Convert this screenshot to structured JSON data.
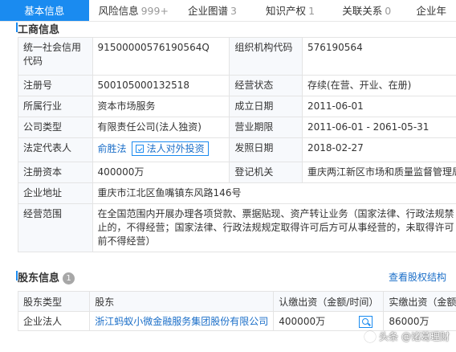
{
  "tabs": [
    {
      "label": "基本信息",
      "count": ""
    },
    {
      "label": "风险信息",
      "count": "999+"
    },
    {
      "label": "企业图谱",
      "count": "3"
    },
    {
      "label": "知识产权",
      "count": "1"
    },
    {
      "label": "关联关系",
      "count": "0"
    },
    {
      "label": "企业年",
      "count": ""
    }
  ],
  "business": {
    "title": "工商信息",
    "credit_code_label": "统一社会信用代码",
    "credit_code": "91500000576190564Q",
    "org_code_label": "组织机构代码",
    "org_code": "576190564",
    "reg_no_label": "注册号",
    "reg_no": "500105000132518",
    "status_label": "经营状态",
    "status": "存续(在营、开业、在册)",
    "industry_label": "所属行业",
    "industry": "资本市场服务",
    "founded_label": "成立日期",
    "founded": "2011-06-01",
    "company_type_label": "公司类型",
    "company_type": "有限责任公司(法人独资)",
    "term_label": "营业期限",
    "term": "2011-06-01 - 2061-05-31",
    "legal_rep_label": "法定代表人",
    "legal_rep": "俞胜法",
    "invest_button": "法人对外投资",
    "license_date_label": "发照日期",
    "license_date": "2018-02-27",
    "capital_label": "注册资本",
    "capital": "400000万",
    "authority_label": "登记机关",
    "authority": "重庆两江新区市场和质量监督管理局",
    "address_label": "企业地址",
    "address": "重庆市江北区鱼嘴镇东风路146号",
    "scope_label": "经营范围",
    "scope": "在全国范围内开展办理各项贷款、票据贴现、资产转让业务（国家法律、行政法规禁止的，不得经营；国家法律、行政法规规定取得许可后方可从事经营的，未取得许可前不得经营）"
  },
  "shareholders": {
    "title": "股东信息",
    "count": "1",
    "view_structure": "查看股权结构",
    "headers": [
      "股东类型",
      "股东",
      "认缴出资（金额/时间）",
      "实缴出资（金额/"
    ],
    "rows": [
      {
        "type": "企业法人",
        "name": "浙江蚂蚁小微金融服务集团股份有限公司",
        "subscribed": "400000万",
        "paid": "86000万"
      }
    ]
  },
  "watermark": "头条 @诸葛理财"
}
